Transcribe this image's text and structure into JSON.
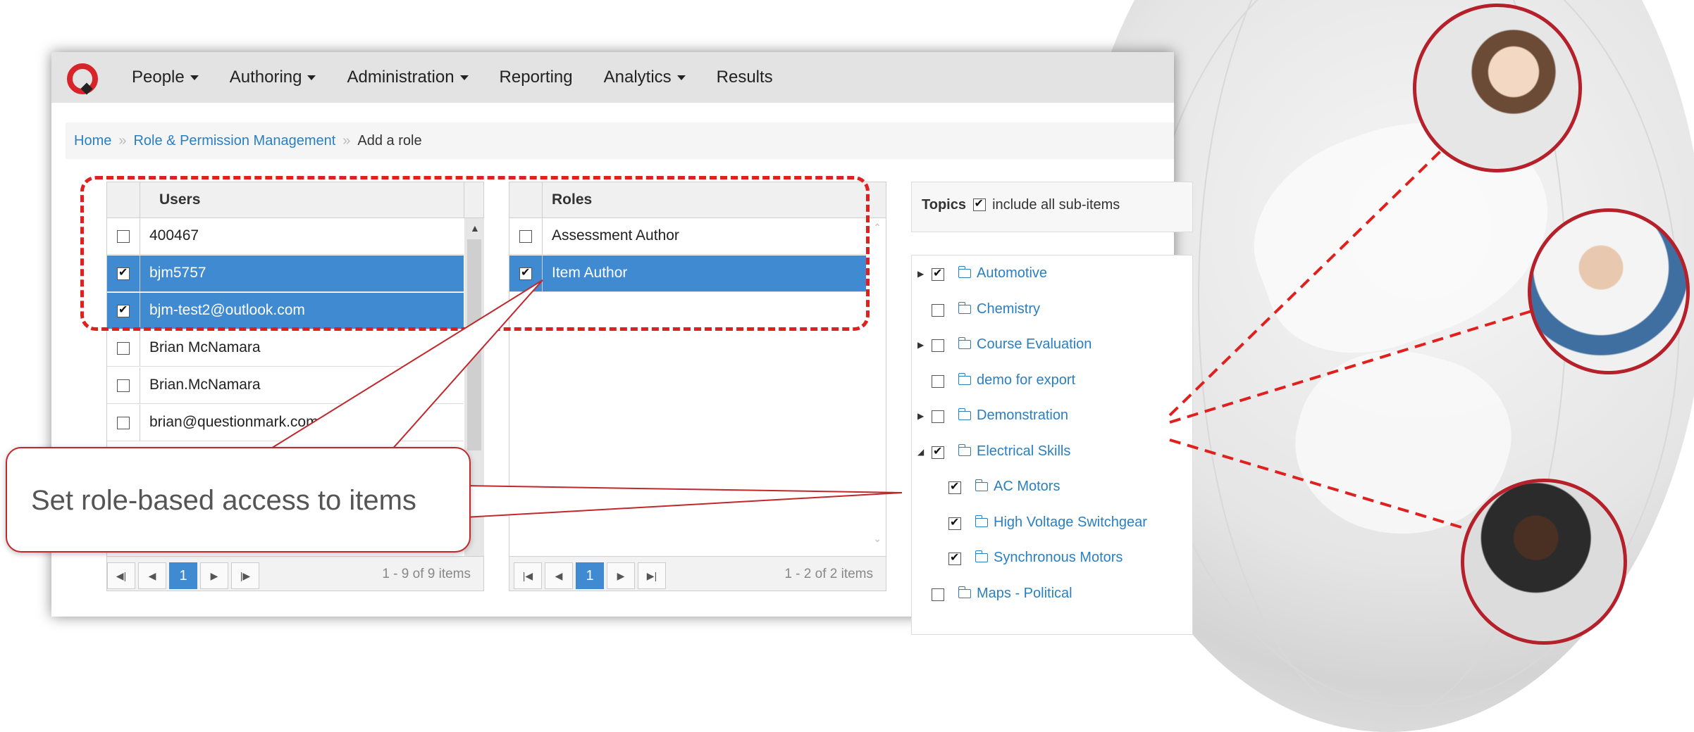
{
  "nav": {
    "items": [
      {
        "label": "People",
        "dropdown": true
      },
      {
        "label": "Authoring",
        "dropdown": true
      },
      {
        "label": "Administration",
        "dropdown": true
      },
      {
        "label": "Reporting",
        "dropdown": false
      },
      {
        "label": "Analytics",
        "dropdown": true
      },
      {
        "label": "Results",
        "dropdown": false
      }
    ]
  },
  "breadcrumb": {
    "home": "Home",
    "section": "Role & Permission Management",
    "current": "Add a role",
    "separator": "»"
  },
  "users": {
    "header": "Users",
    "rows": [
      {
        "label": "400467",
        "checked": false,
        "selected": false
      },
      {
        "label": "bjm5757",
        "checked": true,
        "selected": true
      },
      {
        "label": "bjm-test2@outlook.com",
        "checked": true,
        "selected": true
      },
      {
        "label": "Brian McNamara",
        "checked": false,
        "selected": false
      },
      {
        "label": "Brian.McNamara",
        "checked": false,
        "selected": false
      },
      {
        "label": "brian@questionmark.com",
        "checked": false,
        "selected": false
      }
    ],
    "pager": {
      "page": "1",
      "info": "1 - 9 of 9 items"
    }
  },
  "roles": {
    "header": "Roles",
    "rows": [
      {
        "label": "Assessment Author",
        "checked": false,
        "selected": false
      },
      {
        "label": "Item Author",
        "checked": true,
        "selected": true
      }
    ],
    "pager": {
      "page": "1",
      "info": "1 - 2 of 2 items"
    }
  },
  "topics": {
    "title": "Topics",
    "include_label": "include all sub-items",
    "include_checked": true,
    "items": [
      {
        "label": "Automotive",
        "checked": true,
        "expander": "collapsed",
        "level": 0
      },
      {
        "label": "Chemistry",
        "checked": false,
        "expander": "none",
        "level": 0
      },
      {
        "label": "Course Evaluation",
        "checked": false,
        "expander": "collapsed",
        "level": 0
      },
      {
        "label": "demo for export",
        "checked": false,
        "expander": "none",
        "level": 0
      },
      {
        "label": "Demonstration",
        "checked": false,
        "expander": "collapsed",
        "level": 0
      },
      {
        "label": "Electrical Skills",
        "checked": true,
        "expander": "expanded",
        "level": 0,
        "open": true
      },
      {
        "label": "AC Motors",
        "checked": true,
        "expander": "none",
        "level": 1
      },
      {
        "label": "High Voltage Switchgear",
        "checked": true,
        "expander": "none",
        "level": 1
      },
      {
        "label": "Synchronous Motors",
        "checked": true,
        "expander": "none",
        "level": 1
      },
      {
        "label": "Maps - Political",
        "checked": false,
        "expander": "none",
        "level": 0
      }
    ]
  },
  "callout": {
    "text": "Set role-based access to items"
  },
  "colors": {
    "accent": "#3f8ad0",
    "highlight": "#e0201f",
    "link": "#2a7fc1",
    "brand": "#d8232a"
  }
}
